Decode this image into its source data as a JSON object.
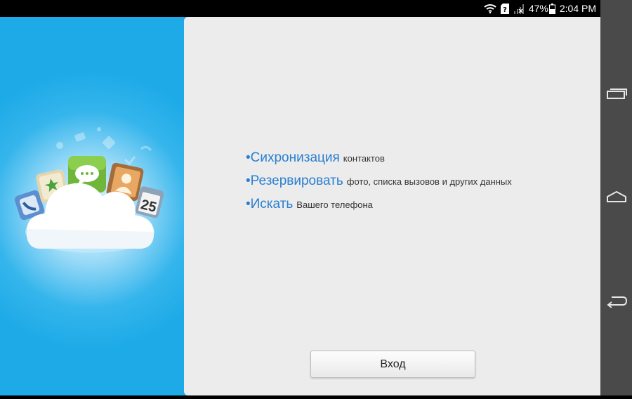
{
  "status": {
    "battery": "47%",
    "time": "2:04 PM"
  },
  "features": [
    {
      "big": "•Сихронизация",
      "small": "контактов"
    },
    {
      "big": "•Резервировать",
      "small": "фото, списка вызовов и других данных"
    },
    {
      "big": "•Искать",
      "small": "Вашего телефона"
    }
  ],
  "login": {
    "label": "Вход"
  },
  "colors": {
    "accent": "#2a7fd0",
    "sidebar_blue": "#1faae6",
    "panel": "#ececec"
  },
  "icons": [
    "wifi-icon",
    "sim-unknown-icon",
    "signal-no-service-icon",
    "battery-icon",
    "recent-apps-icon",
    "home-icon",
    "back-icon",
    "cloud-icon",
    "chat-app-icon",
    "contacts-app-icon",
    "calendar-app-icon",
    "phone-app-icon",
    "star-app-icon"
  ]
}
